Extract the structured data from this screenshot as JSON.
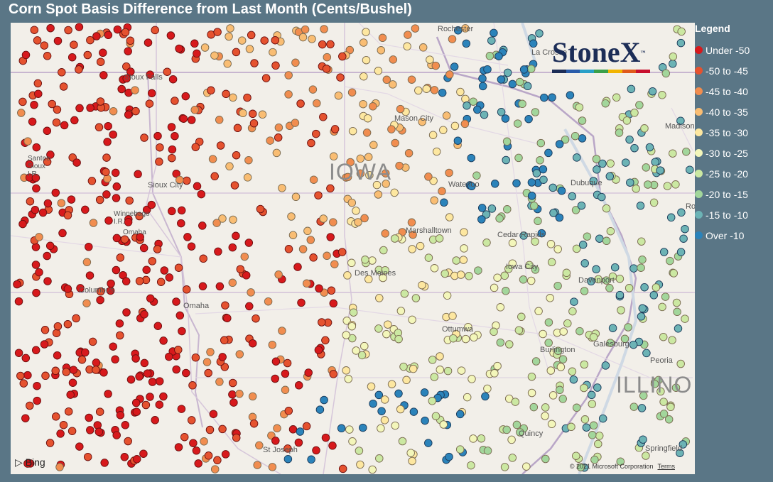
{
  "title": "Corn Spot Basis Difference from Last Month (Cents/Bushel)",
  "legend": {
    "title": "Legend",
    "items": [
      {
        "label": "Under -50",
        "color": "#d7191c"
      },
      {
        "label": "-50 to -45",
        "color": "#e5522f"
      },
      {
        "label": "-45 to -40",
        "color": "#f18d4f"
      },
      {
        "label": "-40 to -35",
        "color": "#f9bd73"
      },
      {
        "label": "-35 to -30",
        "color": "#fde7a0"
      },
      {
        "label": "-30 to -25",
        "color": "#f3f6ba"
      },
      {
        "label": "-25 to -20",
        "color": "#cbe8a2"
      },
      {
        "label": "-20 to -15",
        "color": "#a2d69b"
      },
      {
        "label": "-15 to -10",
        "color": "#6cb3b5"
      },
      {
        "label": "Over -10",
        "color": "#2b83ba"
      }
    ]
  },
  "map": {
    "state_labels": [
      "IOWA",
      "ILLINO"
    ],
    "places": [
      "Rochester",
      "La Crosse",
      "Madison",
      "Sioux Falls",
      "Santee Sioux I.R.",
      "Sioux City",
      "Mason City",
      "Waterloo",
      "Dubuque",
      "Winnebago I.R.",
      "Omaha",
      "Marshalltown",
      "Cedar Rapids",
      "Columbus",
      "Des Moines",
      "Iowa City",
      "Davenport",
      "Omaha",
      "Ottumwa",
      "Burlington",
      "Galesburg",
      "Peoria",
      "Quincy",
      "St Joseph",
      "Springfield",
      "Ro"
    ],
    "attribution": "Bing",
    "copyright": "© 2021 Microsoft Corporation",
    "terms": "Terms"
  },
  "logo": {
    "text": "StoneX",
    "tm": "™",
    "stripe_colors": [
      "#1c2d57",
      "#2a5caa",
      "#2aa0c8",
      "#3aa04a",
      "#f2b400",
      "#e05a1c",
      "#c8102e"
    ]
  }
}
